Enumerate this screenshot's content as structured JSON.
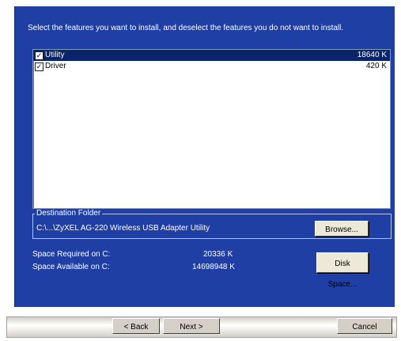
{
  "instruction": "Select the features you want to install, and deselect the features you do not want to install.",
  "features": [
    {
      "name": "Utility",
      "size": "18640 K",
      "checked": true,
      "selected": true
    },
    {
      "name": "Driver",
      "size": "420 K",
      "checked": true,
      "selected": false
    }
  ],
  "destination": {
    "legend": "Destination Folder",
    "path": "C:\\...\\ZyXEL AG-220 Wireless USB Adapter Utility",
    "browse_label": "Browse..."
  },
  "space": {
    "required_label": "Space Required on C:",
    "required_value": "20336 K",
    "available_label": "Space Available on C:",
    "available_value": "14698948 K",
    "disk_space_label": "Disk Space..."
  },
  "nav": {
    "back_label": "< Back",
    "next_label": "Next >",
    "cancel_label": "Cancel"
  }
}
